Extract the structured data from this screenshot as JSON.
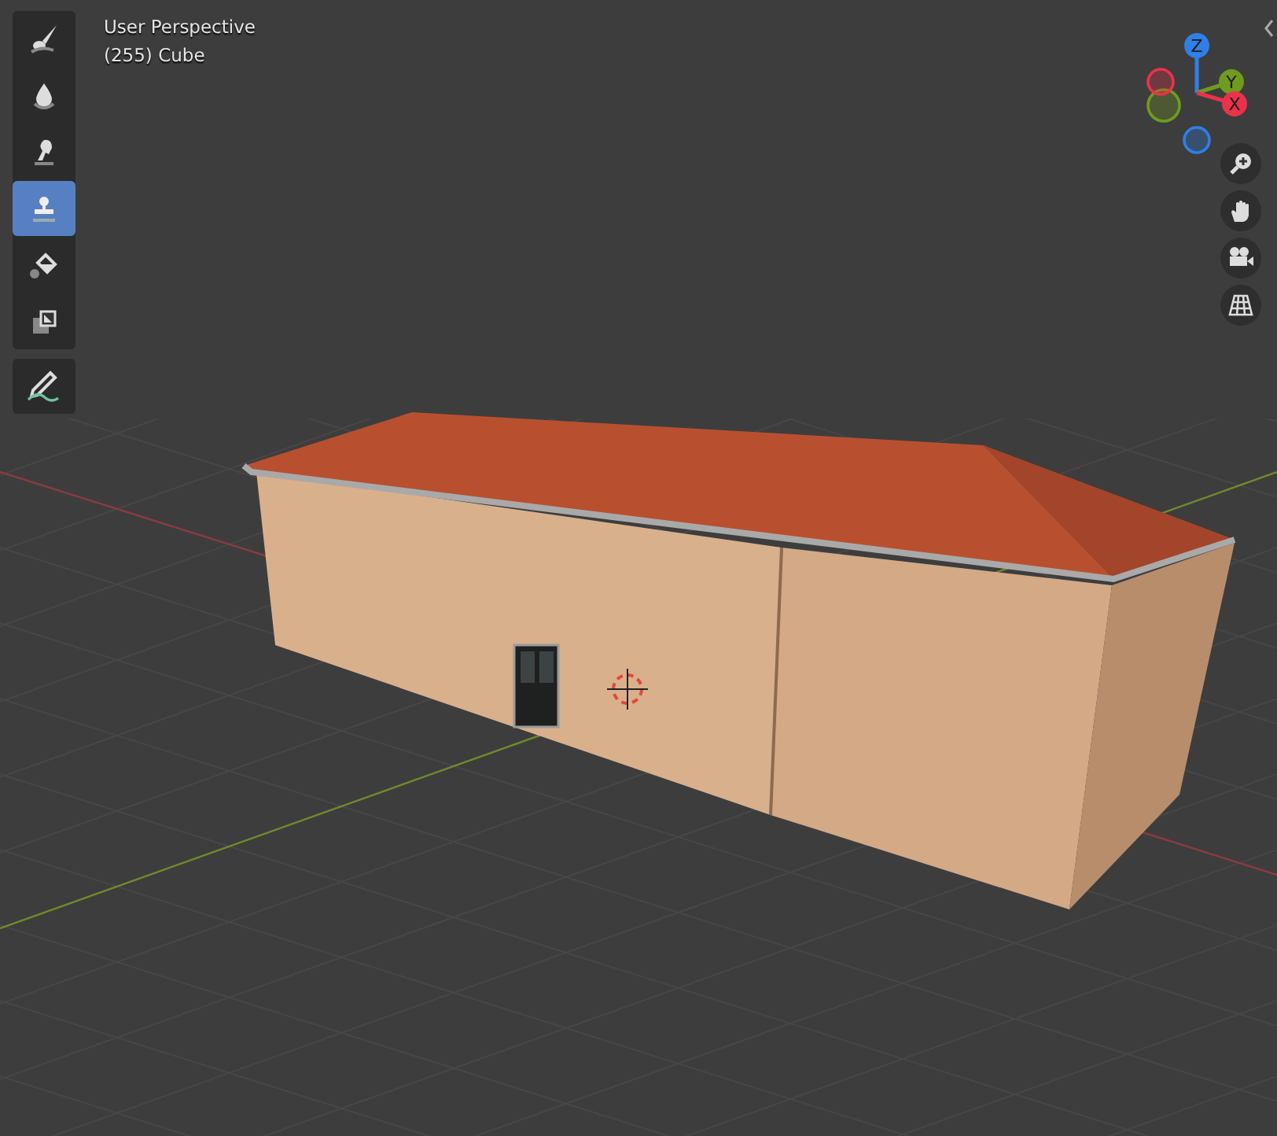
{
  "viewport": {
    "view_name": "User Perspective",
    "object_info": "(255) Cube"
  },
  "toolbar": {
    "groups": [
      {
        "tools": [
          {
            "kind": "brush",
            "selected": false
          },
          {
            "kind": "drop",
            "selected": false
          },
          {
            "kind": "finger",
            "selected": false
          },
          {
            "kind": "stamp",
            "selected": true
          },
          {
            "kind": "bucket",
            "selected": false
          },
          {
            "kind": "layers",
            "selected": false
          }
        ]
      },
      {
        "tools": [
          {
            "kind": "pencil",
            "selected": false
          }
        ]
      }
    ]
  },
  "navigation_gizmo": {
    "axes": [
      {
        "label": "Z",
        "color": "#2f7fe6"
      },
      {
        "label": "Y",
        "color": "#6f9b1e"
      },
      {
        "label": "X",
        "color": "#e8334a"
      }
    ]
  }
}
